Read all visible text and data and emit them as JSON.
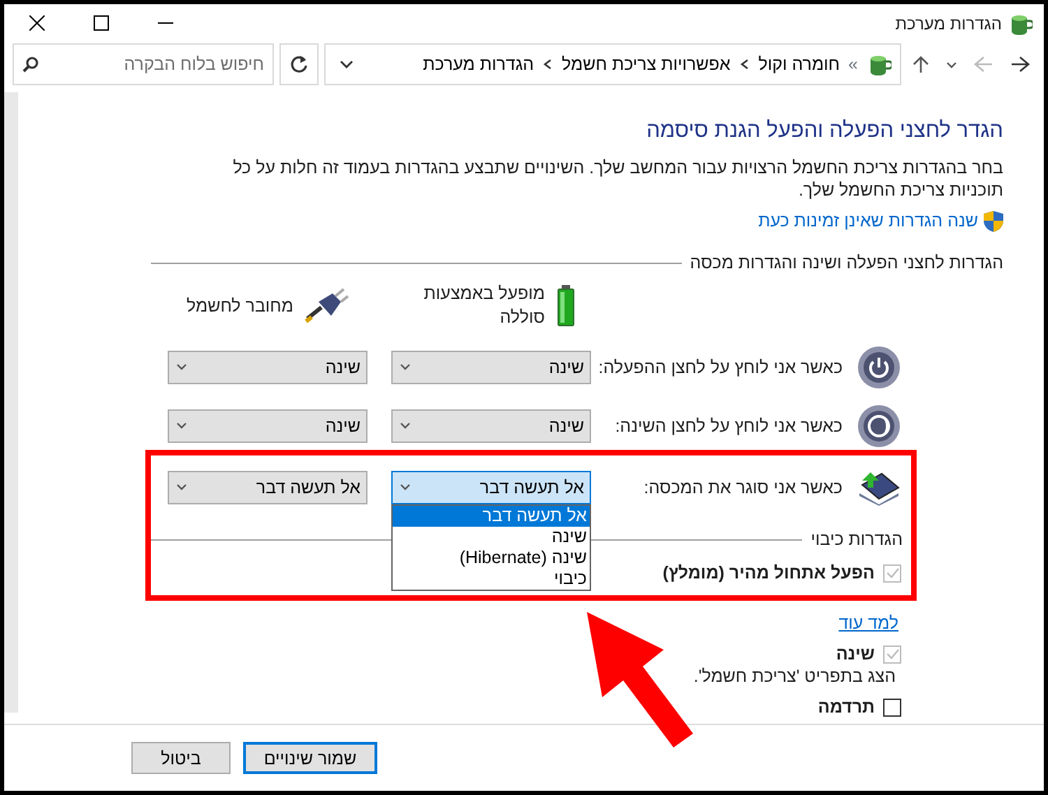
{
  "window": {
    "title": "הגדרות מערכת"
  },
  "address_bar": {
    "overflow": "»",
    "breadcrumbs": [
      "חומרה וקול",
      "אפשרויות צריכת חשמל",
      "הגדרות מערכת"
    ]
  },
  "search": {
    "placeholder": "חיפוש בלוח הבקרה"
  },
  "page": {
    "heading": "הגדר לחצני הפעלה והפעל הגנת סיסמה",
    "description": "בחר בהגדרות צריכת החשמל הרצויות עבור המחשב שלך. השינויים שתבצע בהגדרות בעמוד זה חלות על כל תוכניות צריכת החשמל שלך.",
    "admin_link": "שנה הגדרות שאינן זמינות כעת",
    "buttons_section": {
      "title": "הגדרות לחצני הפעלה ושינה והגדרות מכסה",
      "columns": [
        {
          "kind": "battery",
          "label": "מופעל באמצעות סוללה"
        },
        {
          "kind": "plug",
          "label": "מחובר לחשמל"
        }
      ],
      "rows": [
        {
          "kind": "power",
          "label": "כאשר אני לוחץ על לחצן ההפעלה:",
          "dropdowns": [
            {
              "value": "שינה",
              "expanded": false
            },
            {
              "value": "שינה",
              "expanded": false
            }
          ]
        },
        {
          "kind": "sleep",
          "label": "כאשר אני לוחץ על לחצן השינה:",
          "dropdowns": [
            {
              "value": "שינה",
              "expanded": false
            },
            {
              "value": "שינה",
              "expanded": false
            }
          ]
        },
        {
          "kind": "lid",
          "label": "כאשר אני סוגר את המכסה:",
          "dropdowns": [
            {
              "value": "אל תעשה דבר",
              "expanded": true,
              "options": [
                {
                  "label": "אל תעשה דבר",
                  "selected": true
                },
                {
                  "label": "שינה",
                  "selected": false
                },
                {
                  "label": "שינה (Hibernate)",
                  "selected": false
                },
                {
                  "label": "כיבוי",
                  "selected": false
                }
              ]
            },
            {
              "value": "אל תעשה דבר",
              "expanded": false
            }
          ]
        }
      ]
    },
    "shutdown_section": {
      "title": "הגדרות כיבוי",
      "items": [
        {
          "kind": "checkbox",
          "label": "הפעל אתחול מהיר (מומלץ)",
          "checked": true,
          "disabled": true
        },
        {
          "kind": "link",
          "label": "למד עוד"
        },
        {
          "kind": "checkbox",
          "label": "שינה",
          "checked": true,
          "disabled": true
        },
        {
          "kind": "note",
          "label": "הצג בתפריט 'צריכת חשמל'."
        },
        {
          "kind": "checkbox",
          "label": "תרדמה",
          "checked": false,
          "disabled": false
        }
      ]
    }
  },
  "footer_buttons": [
    {
      "kind": "primary",
      "label": "שמור שינויים"
    },
    {
      "kind": "secondary",
      "label": "ביטול"
    }
  ]
}
